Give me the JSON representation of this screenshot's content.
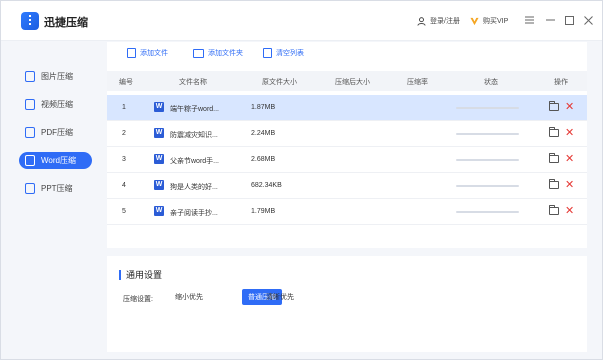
{
  "app": {
    "title": "迅捷压缩"
  },
  "header": {
    "login_label": "登录/注册",
    "vip_label": "购买VIP"
  },
  "sidebar": {
    "items": [
      {
        "label": "图片压缩",
        "active": false
      },
      {
        "label": "视频压缩",
        "active": false
      },
      {
        "label": "PDF压缩",
        "active": false
      },
      {
        "label": "Word压缩",
        "active": true
      },
      {
        "label": "PPT压缩",
        "active": false
      }
    ]
  },
  "toolbar": {
    "add_file": "添加文件",
    "add_folder": "添加文件夹",
    "clear_list": "清空列表"
  },
  "table": {
    "headers": [
      "编号",
      "文件名称",
      "原文件大小",
      "压缩后大小",
      "压缩率",
      "状态",
      "操作"
    ],
    "rows": [
      {
        "index": "1",
        "name": "端午粽子word...",
        "original_size": "1.87MB",
        "compressed_size": "",
        "ratio": "",
        "progress": 0,
        "selected": true
      },
      {
        "index": "2",
        "name": "防震减灾知识...",
        "original_size": "2.24MB",
        "compressed_size": "",
        "ratio": "",
        "progress": 0,
        "selected": false
      },
      {
        "index": "3",
        "name": "父亲节word手...",
        "original_size": "2.68MB",
        "compressed_size": "",
        "ratio": "",
        "progress": 0,
        "selected": false
      },
      {
        "index": "4",
        "name": "狗是人类的好...",
        "original_size": "682.34KB",
        "compressed_size": "",
        "ratio": "",
        "progress": 0,
        "selected": false
      },
      {
        "index": "5",
        "name": "亲子阅读手抄...",
        "original_size": "1.79MB",
        "compressed_size": "",
        "ratio": "",
        "progress": 0,
        "selected": false
      }
    ]
  },
  "settings": {
    "title": "通用设置",
    "compress_label": "压缩设置:",
    "options": [
      {
        "label": "缩小优先",
        "active": false
      },
      {
        "label": "普通压缩",
        "active": true
      },
      {
        "label": "清晰优先",
        "active": false
      }
    ]
  },
  "colors": {
    "accent": "#2f6cf6",
    "delete": "#e53935",
    "selected_row": "#d8e6ff"
  }
}
